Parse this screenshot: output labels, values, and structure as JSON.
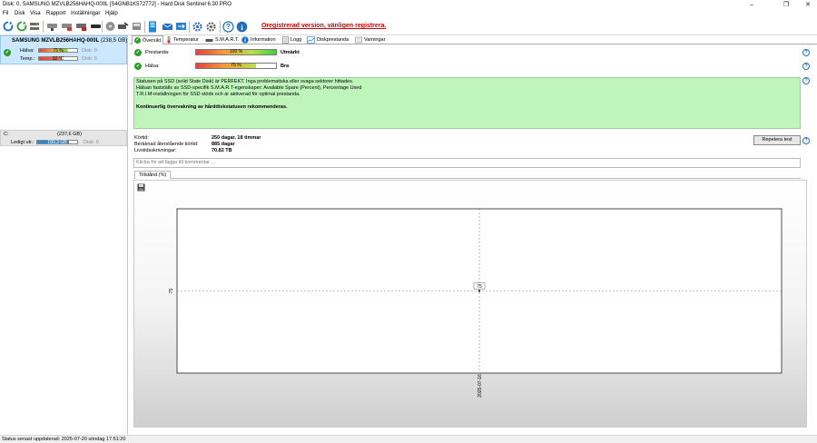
{
  "window": {
    "title": "Disk: 0, SAMSUNG MZVLB256HAHQ-000L [S4GNB1K572772] - Hard Disk Sentinel 6.30 PRO",
    "minimize": "–",
    "maximize": "❐",
    "close": "✕"
  },
  "menu": [
    "Fil",
    "Disk",
    "Visa",
    "Rapport",
    "Inställningar",
    "Hjälp"
  ],
  "toolbar": {
    "icons": [
      "refresh-icon",
      "refresh-all-icon",
      "drive-list-icon",
      "drive-gray-icon",
      "drive-red-icon",
      "drive-red2-icon",
      "drive-black-icon",
      "disk-info-icon",
      "disk-scan-icon",
      "report-icon",
      "mail-report-icon",
      "send-icon",
      "settings-icon",
      "gear-icon",
      "help-icon",
      "info-icon"
    ],
    "registration_link": "Oregistrerad version, vänligen registrera."
  },
  "sidebar": {
    "disk": {
      "name": "SAMSUNG MZVLB256HAHQ-000L",
      "size": "(238,5 GB)",
      "health_label": "Hälsa:",
      "health_value": "75 %",
      "disk_index_1": "Disk: 0",
      "temp_label": "Temp.:",
      "temp_value": "32 °C",
      "disk_index_2": "Disk: 0"
    },
    "volume": {
      "letter": "C:",
      "size": "(237,6 GB)",
      "free_label": "Ledigt utr.:",
      "free_value": "189,3 GB",
      "disk_index": "Disk: 0"
    }
  },
  "tabs": [
    {
      "label": "Översikt",
      "icon": "check-icon"
    },
    {
      "label": "Temperatur",
      "icon": "thermometer-icon"
    },
    {
      "label": "S.M.A.R.T.",
      "icon": "smart-icon"
    },
    {
      "label": "Information",
      "icon": "info-icon"
    },
    {
      "label": "Logg",
      "icon": "log-icon"
    },
    {
      "label": "Diskprestanda",
      "icon": "performance-icon"
    },
    {
      "label": "Varningar",
      "icon": "alert-icon"
    }
  ],
  "overview": {
    "performance_label": "Prestanda:",
    "performance_value": "100 %",
    "performance_fraction": 1.0,
    "performance_rating": "Utmärkt",
    "health_label": "Hälsa:",
    "health_value": "75 %",
    "health_fraction": 0.75,
    "health_rating": "Bra",
    "status_lines": [
      "Statusen på SSD (solid State Disk) är PERFEKT. Inga problematiska eller svaga sektorer hittades.",
      "Hälsan fastställs av SSD-specifik S.M.A.R.T-egenskaper: Available Spare (Percent), Percentage Used",
      "T.R.I.M-inställningen för SSD stöds och är aktiverad för optimal prestanda."
    ],
    "status_recommendation": "Kontinuerlig övervakning av hårddiskstatusen rekommenderas.",
    "powered_on_label": "Körtid:",
    "powered_on_value": "250 dagar, 18 timmar",
    "remaining_label": "Beräknad återstående körtid:",
    "remaining_value": "885 dagar",
    "lifetime_writes_label": "Livstidsskrivningar:",
    "lifetime_writes_value": "70,82 TB",
    "retest_button": "Repetera test",
    "comment_placeholder": "Klicka för att lägga till kommentar ..."
  },
  "chart_tab": "Tillstånd (%)",
  "chart_data": {
    "type": "line",
    "x": [
      "2025-07-16"
    ],
    "y": [
      75
    ],
    "ytick_labels": [
      "75"
    ],
    "xtick_labels": [
      "2025-07-16"
    ],
    "data_labels": [
      "75"
    ],
    "grid": true
  },
  "statusbar": {
    "text": "Status senast uppdaterad: 2025-07-20 söndag 17:51:20"
  },
  "colors": {
    "selection": "#cce8ff",
    "status_good_bg": "#bff5bb",
    "registration_link": "#d00000"
  }
}
